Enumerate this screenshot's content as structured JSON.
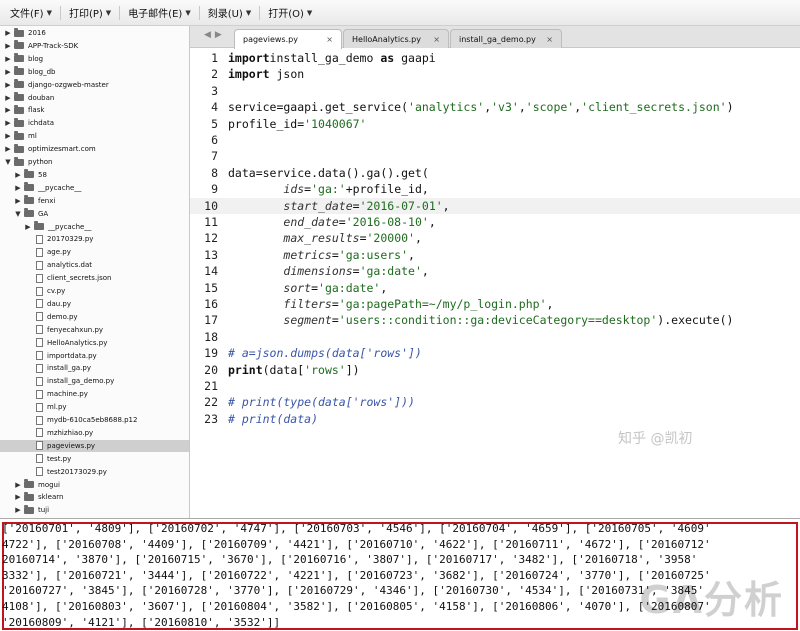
{
  "menu": [
    {
      "label": "文件(F)"
    },
    {
      "label": "打印(P)"
    },
    {
      "label": "电子邮件(E)"
    },
    {
      "label": "刻录(U)"
    },
    {
      "label": "打开(O)"
    }
  ],
  "tree": [
    {
      "label": "2016",
      "type": "folder",
      "level": 0,
      "expanded": false
    },
    {
      "label": "APP-Track-SDK",
      "type": "folder",
      "level": 0,
      "expanded": false
    },
    {
      "label": "blog",
      "type": "folder",
      "level": 0,
      "expanded": false
    },
    {
      "label": "blog_db",
      "type": "folder",
      "level": 0,
      "expanded": false
    },
    {
      "label": "django-ozgweb-master",
      "type": "folder",
      "level": 0,
      "expanded": false
    },
    {
      "label": "douban",
      "type": "folder",
      "level": 0,
      "expanded": false
    },
    {
      "label": "flask",
      "type": "folder",
      "level": 0,
      "expanded": false
    },
    {
      "label": "ichdata",
      "type": "folder",
      "level": 0,
      "expanded": false
    },
    {
      "label": "ml",
      "type": "folder",
      "level": 0,
      "expanded": false
    },
    {
      "label": "optimizesmart.com",
      "type": "folder",
      "level": 0,
      "expanded": false
    },
    {
      "label": "python",
      "type": "folder",
      "level": 0,
      "expanded": true
    },
    {
      "label": "58",
      "type": "folder",
      "level": 1,
      "expanded": false
    },
    {
      "label": "__pycache__",
      "type": "folder",
      "level": 1,
      "expanded": false
    },
    {
      "label": "fenxi",
      "type": "folder",
      "level": 1,
      "expanded": false
    },
    {
      "label": "GA",
      "type": "folder",
      "level": 1,
      "expanded": true
    },
    {
      "label": "__pycache__",
      "type": "folder",
      "level": 2,
      "expanded": false
    },
    {
      "label": "20170329.py",
      "type": "file",
      "level": 2
    },
    {
      "label": "age.py",
      "type": "file",
      "level": 2
    },
    {
      "label": "analytics.dat",
      "type": "file",
      "level": 2
    },
    {
      "label": "client_secrets.json",
      "type": "file",
      "level": 2
    },
    {
      "label": "cv.py",
      "type": "file",
      "level": 2
    },
    {
      "label": "dau.py",
      "type": "file",
      "level": 2
    },
    {
      "label": "demo.py",
      "type": "file",
      "level": 2
    },
    {
      "label": "fenyecahxun.py",
      "type": "file",
      "level": 2
    },
    {
      "label": "HelloAnalytics.py",
      "type": "file",
      "level": 2
    },
    {
      "label": "importdata.py",
      "type": "file",
      "level": 2
    },
    {
      "label": "install_ga.py",
      "type": "file",
      "level": 2
    },
    {
      "label": "install_ga_demo.py",
      "type": "file",
      "level": 2
    },
    {
      "label": "machine.py",
      "type": "file",
      "level": 2
    },
    {
      "label": "ml.py",
      "type": "file",
      "level": 2
    },
    {
      "label": "mydb-610ca5eb8688.p12",
      "type": "file",
      "level": 2
    },
    {
      "label": "mzhizhiao.py",
      "type": "file",
      "level": 2
    },
    {
      "label": "pageviews.py",
      "type": "file",
      "level": 2,
      "selected": true
    },
    {
      "label": "test.py",
      "type": "file",
      "level": 2
    },
    {
      "label": "test20173029.py",
      "type": "file",
      "level": 2
    },
    {
      "label": "mogui",
      "type": "folder",
      "level": 1,
      "expanded": false
    },
    {
      "label": "sklearn",
      "type": "folder",
      "level": 1,
      "expanded": false
    },
    {
      "label": "tuji",
      "type": "folder",
      "level": 1,
      "expanded": false
    }
  ],
  "tabs": [
    {
      "label": "pageviews.py",
      "close": "×",
      "active": true
    },
    {
      "label": "HelloAnalytics.py",
      "close": "×",
      "active": false
    },
    {
      "label": "install_ga_demo.py",
      "close": "×",
      "active": false
    }
  ],
  "editor": {
    "current_line": 10,
    "lines": [
      {
        "n": "1",
        "tokens": [
          [
            "kw",
            "import"
          ],
          [
            "",
            "install_ga_demo "
          ],
          [
            "kw",
            "as"
          ],
          [
            "",
            " gaapi"
          ]
        ]
      },
      {
        "n": "2",
        "tokens": [
          [
            "kw",
            "import"
          ],
          [
            "",
            " json"
          ]
        ]
      },
      {
        "n": "3",
        "tokens": []
      },
      {
        "n": "4",
        "tokens": [
          [
            "",
            "service=gaapi.get_service("
          ],
          [
            "str",
            "'analytics'"
          ],
          [
            "",
            ","
          ],
          [
            "str",
            "'v3'"
          ],
          [
            "",
            ","
          ],
          [
            "str",
            "'scope'"
          ],
          [
            "",
            ","
          ],
          [
            "str",
            "'client_secrets.json'"
          ],
          [
            "",
            ")"
          ]
        ]
      },
      {
        "n": "5",
        "tokens": [
          [
            "",
            "profile_id="
          ],
          [
            "str",
            "'1040067'"
          ]
        ]
      },
      {
        "n": "6",
        "tokens": []
      },
      {
        "n": "7",
        "tokens": []
      },
      {
        "n": "8",
        "tokens": [
          [
            "",
            "data=service.data().ga().get("
          ]
        ]
      },
      {
        "n": "9",
        "tokens": [
          [
            "",
            "        "
          ],
          [
            "kwarg",
            "ids"
          ],
          [
            "",
            "="
          ],
          [
            "str",
            "'ga:'"
          ],
          [
            "",
            "+profile_id,"
          ]
        ]
      },
      {
        "n": "10",
        "tokens": [
          [
            "",
            "        "
          ],
          [
            "kwarg",
            "start_date"
          ],
          [
            "",
            "="
          ],
          [
            "str",
            "'2016-07-01'"
          ],
          [
            "",
            ","
          ]
        ]
      },
      {
        "n": "11",
        "tokens": [
          [
            "",
            "        "
          ],
          [
            "kwarg",
            "end_date"
          ],
          [
            "",
            "="
          ],
          [
            "str",
            "'2016-08-10'"
          ],
          [
            "",
            ","
          ]
        ]
      },
      {
        "n": "12",
        "tokens": [
          [
            "",
            "        "
          ],
          [
            "kwarg",
            "max_results"
          ],
          [
            "",
            "="
          ],
          [
            "str",
            "'20000'"
          ],
          [
            "",
            ","
          ]
        ]
      },
      {
        "n": "13",
        "tokens": [
          [
            "",
            "        "
          ],
          [
            "kwarg",
            "metrics"
          ],
          [
            "",
            "="
          ],
          [
            "str",
            "'ga:users'"
          ],
          [
            "",
            ","
          ]
        ]
      },
      {
        "n": "14",
        "tokens": [
          [
            "",
            "        "
          ],
          [
            "kwarg",
            "dimensions"
          ],
          [
            "",
            "="
          ],
          [
            "str",
            "'ga:date'"
          ],
          [
            "",
            ","
          ]
        ]
      },
      {
        "n": "15",
        "tokens": [
          [
            "",
            "        "
          ],
          [
            "kwarg",
            "sort"
          ],
          [
            "",
            "="
          ],
          [
            "str",
            "'ga:date'"
          ],
          [
            "",
            ","
          ]
        ]
      },
      {
        "n": "16",
        "tokens": [
          [
            "",
            "        "
          ],
          [
            "kwarg",
            "filters"
          ],
          [
            "",
            "="
          ],
          [
            "str",
            "'ga:pagePath=~/my/p_login.php'"
          ],
          [
            "",
            ","
          ]
        ]
      },
      {
        "n": "17",
        "tokens": [
          [
            "",
            "        "
          ],
          [
            "kwarg",
            "segment"
          ],
          [
            "",
            "="
          ],
          [
            "str",
            "'users::condition::ga:deviceCategory==desktop'"
          ],
          [
            "",
            ").execute()"
          ]
        ]
      },
      {
        "n": "18",
        "tokens": []
      },
      {
        "n": "19",
        "tokens": [
          [
            "cmt",
            "# a=json.dumps(data['rows'])"
          ]
        ]
      },
      {
        "n": "20",
        "tokens": [
          [
            "kw",
            "print"
          ],
          [
            "",
            "(data["
          ],
          [
            "str",
            "'rows'"
          ],
          [
            "",
            "])"
          ]
        ]
      },
      {
        "n": "21",
        "tokens": []
      },
      {
        "n": "22",
        "tokens": [
          [
            "cmt",
            "# print(type(data['rows']))"
          ]
        ]
      },
      {
        "n": "23",
        "tokens": [
          [
            "cmt",
            "# print(data)"
          ]
        ]
      }
    ]
  },
  "output": {
    "lines": [
      "['20160701', '4809'], ['20160702', '4747'], ['20160703', '4546'], ['20160704', '4659'], ['20160705', '4609'",
      "4722'], ['20160708', '4409'], ['20160709', '4421'], ['20160710', '4622'], ['20160711', '4672'], ['20160712'",
      "20160714', '3870'], ['20160715', '3670'], ['20160716', '3807'], ['20160717', '3482'], ['20160718', '3958'",
      "3332'], ['20160721', '3444'], ['20160722', '4221'], ['20160723', '3682'], ['20160724', '3770'], ['20160725'",
      "'20160727', '3845'], ['20160728', '3770'], ['20160729', '4346'], ['20160730', '4534'], ['20160731', '3845'",
      "4108'], ['20160803', '3607'], ['20160804', '3582'], ['20160805', '4158'], ['20160806', '4070'], ['20160807'",
      "'20160809', '4121'], ['20160810', '3532']]"
    ],
    "watermark": "GA分析",
    "watermark_small": "知乎 @凯初"
  }
}
